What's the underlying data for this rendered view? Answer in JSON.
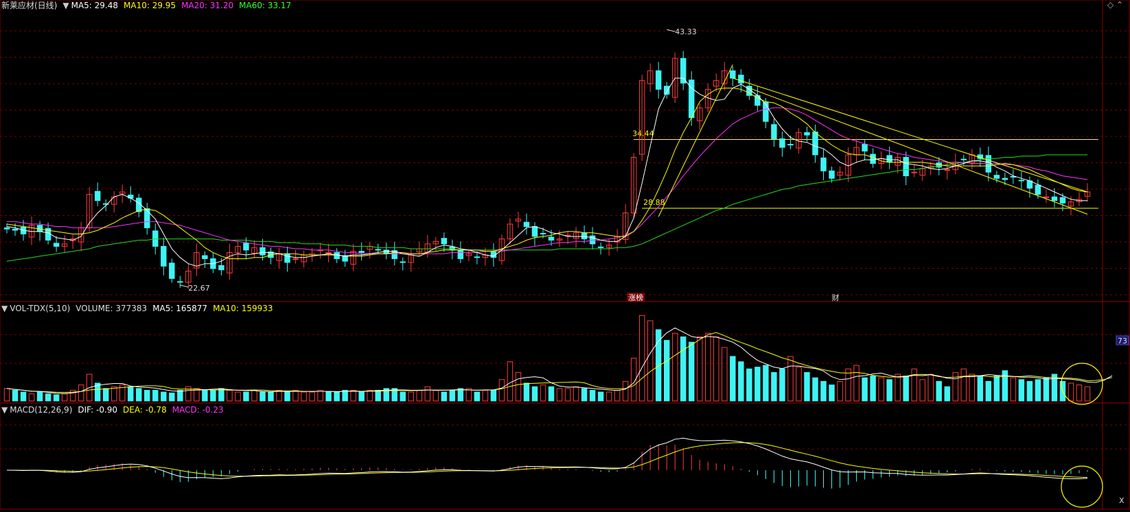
{
  "header": {
    "stock_name": "新莱应材(日线)",
    "ma": [
      {
        "label": "MA5: 29.48",
        "color": "#ffffff"
      },
      {
        "label": "MA10: 29.95",
        "color": "#ffff00"
      },
      {
        "label": "MA20: 31.20",
        "color": "#ff33ff"
      },
      {
        "label": "MA60: 33.17",
        "color": "#33ff33"
      }
    ]
  },
  "vol_header": {
    "name": "VOL-TDX(5,10)",
    "volume": "VOLUME: 377383",
    "ma5": "MA5: 165877",
    "ma10": "MA10: 159933"
  },
  "macd_header": {
    "name": "MACD(12,26,9)",
    "dif": "DIF: -0.90",
    "dea": "DEA: -0.78",
    "macd": "MACD: -0.23"
  },
  "annotations": {
    "high_label": "43.33",
    "low_label": "22.67",
    "level_upper": "34.44",
    "level_lower": "28.88",
    "event_limitup": "涨榜",
    "event_finance": "财",
    "vol_axis_cut": "73",
    "macd_axis_cut": "X"
  },
  "colors": {
    "up": "#ff3b3b",
    "down": "#3ff4f4",
    "ma5": "#ffffff",
    "ma10": "#ffff00",
    "ma20": "#ff33ff",
    "ma60": "#22dd22",
    "grid": "#7a0000",
    "level": "#ffff00"
  },
  "chart_data": {
    "type": "candlestick",
    "price_range": [
      21.5,
      44.5
    ],
    "high": 43.33,
    "low": 22.67,
    "levels": [
      34.44,
      28.88
    ],
    "closes": [
      27.2,
      27.1,
      26.8,
      27.5,
      27.0,
      26.3,
      25.8,
      26.0,
      26.4,
      27.3,
      30.0,
      29.5,
      29.2,
      29.8,
      30.2,
      29.7,
      28.6,
      27.3,
      25.8,
      24.2,
      23.2,
      22.9,
      23.8,
      25.3,
      24.8,
      24.0,
      23.9,
      25.3,
      25.8,
      25.5,
      25.7,
      25.1,
      24.9,
      25.2,
      24.5,
      24.8,
      25.1,
      25.2,
      25.5,
      25.3,
      24.8,
      24.6,
      25.4,
      25.3,
      25.8,
      25.5,
      25.2,
      24.8,
      24.5,
      25.1,
      25.6,
      26.0,
      26.2,
      26.0,
      25.5,
      24.8,
      25.2,
      24.9,
      25.1,
      24.9,
      26.4,
      27.6,
      28.0,
      27.4,
      26.6,
      26.8,
      26.3,
      26.4,
      26.7,
      26.9,
      26.4,
      26.0,
      25.7,
      25.9,
      26.6,
      28.5,
      33.0,
      39.2,
      40.0,
      38.5,
      38.1,
      41.0,
      39.0,
      36.2,
      37.0,
      38.5,
      39.2,
      40.0,
      39.4,
      39.0,
      38.0,
      37.2,
      35.9,
      34.5,
      33.8,
      34.0,
      35.0,
      34.8,
      33.2,
      31.9,
      31.3,
      31.8,
      33.2,
      33.8,
      33.5,
      32.5,
      32.9,
      32.6,
      33.0,
      31.5,
      31.8,
      32.1,
      32.3,
      32.2,
      32.0,
      32.6,
      32.8,
      33.2,
      32.9,
      31.8,
      31.3,
      31.2,
      31.4,
      31.1,
      30.5,
      30.0,
      29.8,
      29.5,
      29.3,
      29.4,
      29.6,
      30.2
    ],
    "volumes": [
      70,
      60,
      50,
      40,
      50,
      40,
      35,
      40,
      60,
      90,
      150,
      100,
      70,
      80,
      90,
      80,
      70,
      60,
      60,
      50,
      45,
      60,
      80,
      70,
      60,
      60,
      70,
      60,
      50,
      50,
      60,
      50,
      50,
      60,
      50,
      60,
      50,
      50,
      60,
      50,
      50,
      60,
      60,
      50,
      60,
      60,
      70,
      70,
      50,
      50,
      60,
      80,
      60,
      50,
      60,
      70,
      70,
      50,
      60,
      60,
      120,
      220,
      160,
      100,
      80,
      90,
      80,
      70,
      70,
      80,
      70,
      60,
      50,
      50,
      60,
      110,
      240,
      480,
      450,
      400,
      340,
      380,
      360,
      330,
      360,
      380,
      360,
      300,
      250,
      220,
      180,
      190,
      200,
      160,
      180,
      250,
      190,
      160,
      130,
      110,
      90,
      110,
      180,
      200,
      130,
      140,
      130,
      120,
      150,
      140,
      180,
      120,
      150,
      110,
      80,
      160,
      180,
      150,
      140,
      110,
      140,
      170,
      130,
      120,
      110,
      120,
      130,
      150,
      110,
      100,
      90,
      80,
      140,
      170,
      230
    ],
    "ma5": [
      27.4,
      27.3,
      27.1,
      27.0,
      27.0,
      26.9,
      26.5,
      26.4,
      26.3,
      26.6,
      27.7,
      28.5,
      29.1,
      29.8,
      30.0,
      29.7,
      29.3,
      28.7,
      28.0,
      26.8,
      25.6,
      24.9,
      24.4,
      24.2,
      24.4,
      24.4,
      24.6,
      25.0,
      25.2,
      25.1,
      25.2,
      25.3,
      25.3,
      25.2,
      25.0,
      24.9,
      24.9,
      25.0,
      25.1,
      25.2,
      25.1,
      25.0,
      25.1,
      25.1,
      25.2,
      25.3,
      25.4,
      25.4,
      25.2,
      25.1,
      25.0,
      25.3,
      25.7,
      25.9,
      25.8,
      25.6,
      25.5,
      25.3,
      25.1,
      25.0,
      25.5,
      26.1,
      26.7,
      27.3,
      27.4,
      27.2,
      26.9,
      26.8,
      26.6,
      26.6,
      26.6,
      26.5,
      26.3,
      26.2,
      26.2,
      26.6,
      28.1,
      30.9,
      33.9,
      36.9,
      38.3,
      39.4,
      39.4,
      38.6,
      38.1,
      37.8,
      37.6,
      37.7,
      38.6,
      38.9,
      38.5,
      38.0,
      37.3,
      36.2,
      35.3,
      34.6,
      34.3,
      34.2,
      33.9,
      33.7,
      33.2,
      32.6,
      32.3,
      32.6,
      32.8,
      32.8,
      32.9,
      32.8,
      32.8,
      32.5,
      32.4,
      32.3,
      32.1,
      32.0,
      32.1,
      32.3,
      32.5,
      32.7,
      32.7,
      32.6,
      32.2,
      31.9,
      31.5,
      31.3,
      31.1,
      30.8,
      30.5,
      30.2,
      29.9,
      29.6,
      29.5,
      29.5
    ],
    "ma10": [
      27.6,
      27.5,
      27.4,
      27.3,
      27.2,
      27.1,
      27.0,
      26.9,
      26.8,
      26.8,
      26.9,
      27.1,
      27.4,
      27.7,
      28.1,
      28.4,
      28.7,
      28.8,
      28.7,
      28.3,
      27.8,
      27.3,
      26.8,
      26.3,
      25.7,
      25.3,
      25.0,
      24.8,
      24.8,
      24.8,
      24.9,
      24.9,
      25.1,
      25.2,
      25.2,
      25.2,
      25.1,
      25.1,
      25.1,
      25.1,
      25.1,
      25.0,
      25.0,
      25.0,
      25.1,
      25.2,
      25.2,
      25.3,
      25.3,
      25.2,
      25.2,
      25.3,
      25.4,
      25.5,
      25.5,
      25.5,
      25.5,
      25.5,
      25.4,
      25.4,
      25.6,
      25.8,
      26.0,
      26.3,
      26.5,
      26.6,
      26.7,
      26.9,
      27.0,
      27.0,
      26.9,
      26.9,
      26.8,
      26.7,
      26.6,
      26.6,
      27.0,
      27.9,
      29.0,
      30.4,
      31.9,
      33.6,
      35.0,
      36.2,
      37.5,
      38.1,
      38.5,
      38.6,
      38.6,
      38.5,
      38.2,
      37.8,
      37.5,
      37.4,
      37.1,
      36.6,
      36.2,
      35.7,
      35.0,
      34.5,
      34.0,
      33.6,
      33.3,
      33.2,
      33.2,
      33.0,
      32.7,
      32.6,
      32.6,
      32.6,
      32.6,
      32.6,
      32.5,
      32.4,
      32.3,
      32.3,
      32.3,
      32.3,
      32.3,
      32.3,
      32.4,
      32.5,
      32.4,
      32.2,
      32.0,
      31.7,
      31.4,
      31.1,
      30.8,
      30.5,
      30.3,
      30.2
    ],
    "ma20": [
      27.8,
      27.8,
      27.7,
      27.6,
      27.6,
      27.5,
      27.4,
      27.4,
      27.3,
      27.3,
      27.3,
      27.3,
      27.3,
      27.4,
      27.5,
      27.6,
      27.7,
      27.8,
      27.8,
      27.7,
      27.6,
      27.5,
      27.3,
      27.1,
      26.9,
      26.7,
      26.5,
      26.3,
      26.2,
      26.1,
      26.0,
      25.9,
      25.8,
      25.8,
      25.7,
      25.6,
      25.6,
      25.5,
      25.5,
      25.5,
      25.4,
      25.3,
      25.3,
      25.2,
      25.2,
      25.2,
      25.2,
      25.2,
      25.2,
      25.2,
      25.2,
      25.2,
      25.2,
      25.2,
      25.3,
      25.3,
      25.3,
      25.3,
      25.4,
      25.4,
      25.4,
      25.5,
      25.6,
      25.7,
      25.8,
      25.9,
      26.0,
      26.1,
      26.1,
      26.2,
      26.2,
      26.3,
      26.3,
      26.4,
      26.5,
      26.7,
      27.0,
      27.6,
      28.3,
      29.0,
      29.8,
      30.6,
      31.5,
      32.3,
      33.1,
      33.8,
      34.5,
      35.1,
      35.7,
      36.1,
      36.4,
      36.7,
      36.9,
      37.0,
      37.0,
      36.9,
      36.7,
      36.4,
      36.0,
      35.6,
      35.2,
      34.8,
      34.5,
      34.3,
      34.1,
      33.9,
      33.7,
      33.5,
      33.3,
      33.2,
      33.0,
      32.9,
      32.8,
      32.7,
      32.6,
      32.6,
      32.6,
      32.5,
      32.5,
      32.5,
      32.5,
      32.4,
      32.4,
      32.3,
      32.2,
      32.0,
      31.9,
      31.7,
      31.5,
      31.4,
      31.3,
      31.2
    ],
    "ma60": [
      24.6,
      24.7,
      24.8,
      24.9,
      25.0,
      25.1,
      25.2,
      25.3,
      25.4,
      25.5,
      25.6,
      25.8,
      25.9,
      26.0,
      26.1,
      26.2,
      26.3,
      26.3,
      26.4,
      26.4,
      26.4,
      26.4,
      26.4,
      26.4,
      26.4,
      26.4,
      26.3,
      26.3,
      26.3,
      26.3,
      26.2,
      26.2,
      26.2,
      26.1,
      26.1,
      26.1,
      26.0,
      26.0,
      26.0,
      25.9,
      25.9,
      25.9,
      25.8,
      25.8,
      25.8,
      25.7,
      25.7,
      25.7,
      25.7,
      25.6,
      25.6,
      25.6,
      25.6,
      25.6,
      25.6,
      25.5,
      25.5,
      25.5,
      25.5,
      25.5,
      25.5,
      25.5,
      25.5,
      25.5,
      25.5,
      25.5,
      25.5,
      25.6,
      25.6,
      25.6,
      25.6,
      25.6,
      25.6,
      25.6,
      25.7,
      25.7,
      25.8,
      26.0,
      26.3,
      26.6,
      26.9,
      27.2,
      27.5,
      27.8,
      28.1,
      28.4,
      28.7,
      28.9,
      29.2,
      29.4,
      29.6,
      29.8,
      30.0,
      30.2,
      30.4,
      30.5,
      30.7,
      30.8,
      30.9,
      31.0,
      31.1,
      31.2,
      31.3,
      31.4,
      31.5,
      31.6,
      31.7,
      31.8,
      31.9,
      32.0,
      32.0,
      32.1,
      32.2,
      32.3,
      32.4,
      32.5,
      32.6,
      32.7,
      32.8,
      32.9,
      32.9,
      33.0,
      33.0,
      33.1,
      33.1,
      33.1,
      33.2,
      33.2,
      33.2,
      33.2,
      33.2,
      33.2
    ],
    "vol_ma5": [],
    "vol_ma10": [],
    "dif": [],
    "dea": [],
    "macd": []
  }
}
